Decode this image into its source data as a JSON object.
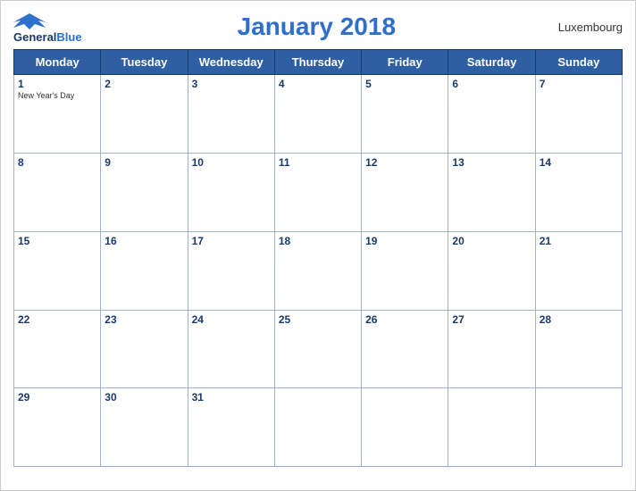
{
  "header": {
    "logo_general": "General",
    "logo_blue": "Blue",
    "title": "January 2018",
    "country": "Luxembourg"
  },
  "weekdays": [
    "Monday",
    "Tuesday",
    "Wednesday",
    "Thursday",
    "Friday",
    "Saturday",
    "Sunday"
  ],
  "weeks": [
    [
      {
        "day": "1",
        "holiday": "New Year's Day"
      },
      {
        "day": "2",
        "holiday": ""
      },
      {
        "day": "3",
        "holiday": ""
      },
      {
        "day": "4",
        "holiday": ""
      },
      {
        "day": "5",
        "holiday": ""
      },
      {
        "day": "6",
        "holiday": ""
      },
      {
        "day": "7",
        "holiday": ""
      }
    ],
    [
      {
        "day": "8",
        "holiday": ""
      },
      {
        "day": "9",
        "holiday": ""
      },
      {
        "day": "10",
        "holiday": ""
      },
      {
        "day": "11",
        "holiday": ""
      },
      {
        "day": "12",
        "holiday": ""
      },
      {
        "day": "13",
        "holiday": ""
      },
      {
        "day": "14",
        "holiday": ""
      }
    ],
    [
      {
        "day": "15",
        "holiday": ""
      },
      {
        "day": "16",
        "holiday": ""
      },
      {
        "day": "17",
        "holiday": ""
      },
      {
        "day": "18",
        "holiday": ""
      },
      {
        "day": "19",
        "holiday": ""
      },
      {
        "day": "20",
        "holiday": ""
      },
      {
        "day": "21",
        "holiday": ""
      }
    ],
    [
      {
        "day": "22",
        "holiday": ""
      },
      {
        "day": "23",
        "holiday": ""
      },
      {
        "day": "24",
        "holiday": ""
      },
      {
        "day": "25",
        "holiday": ""
      },
      {
        "day": "26",
        "holiday": ""
      },
      {
        "day": "27",
        "holiday": ""
      },
      {
        "day": "28",
        "holiday": ""
      }
    ],
    [
      {
        "day": "29",
        "holiday": ""
      },
      {
        "day": "30",
        "holiday": ""
      },
      {
        "day": "31",
        "holiday": ""
      },
      {
        "day": "",
        "holiday": ""
      },
      {
        "day": "",
        "holiday": ""
      },
      {
        "day": "",
        "holiday": ""
      },
      {
        "day": "",
        "holiday": ""
      }
    ]
  ]
}
